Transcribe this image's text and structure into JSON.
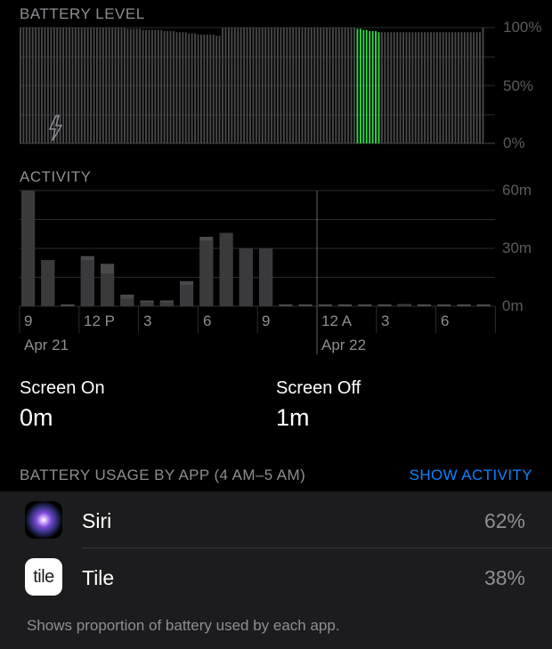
{
  "battery": {
    "label": "BATTERY LEVEL",
    "axis": [
      "100%",
      "50%",
      "0%"
    ],
    "charging_icon": "lightning-bolt-icon",
    "bar_color": "#48484a",
    "highlight_color": "#32d74b",
    "levels": [
      100,
      100,
      100,
      100,
      100,
      100,
      100,
      100,
      100,
      100,
      100,
      100,
      100,
      100,
      100,
      100,
      100,
      100,
      100,
      100,
      100,
      100,
      100,
      100,
      100,
      100,
      100,
      100,
      100,
      100,
      100,
      100,
      100,
      100,
      100,
      99,
      99,
      99,
      99,
      99,
      98,
      98,
      98,
      98,
      98,
      98,
      98,
      97,
      97,
      97,
      97,
      96,
      96,
      96,
      96,
      95,
      95,
      95,
      94,
      94,
      94,
      94,
      94,
      94,
      93,
      93,
      100,
      100,
      100,
      100,
      100,
      100,
      100,
      100,
      100,
      100,
      100,
      100,
      100,
      100,
      100,
      100,
      100,
      100,
      100,
      100,
      100,
      100,
      100,
      100,
      100,
      100,
      100,
      100,
      100,
      100,
      100,
      100,
      100,
      100,
      100,
      100,
      100,
      100,
      100,
      100,
      100,
      100,
      100,
      100,
      99,
      99,
      98,
      98,
      97,
      97,
      97,
      96,
      96,
      96,
      96,
      96,
      96,
      96,
      96,
      96,
      96,
      96,
      96,
      96,
      96,
      96,
      96,
      96,
      96,
      96,
      96,
      96,
      96,
      96,
      96,
      96,
      96,
      96,
      96,
      96,
      96,
      96,
      96,
      96,
      96,
      100
    ],
    "highlight_index_range": [
      110,
      118
    ]
  },
  "activity": {
    "label": "ACTIVITY",
    "axis": [
      "60m",
      "30m",
      "0m"
    ],
    "time_ticks": [
      "9",
      "12 P",
      "3",
      "6",
      "9",
      "12 A",
      "3",
      "6"
    ],
    "date_labels": [
      "Apr 21",
      "Apr 22"
    ],
    "bar_color": "#3a3a3c",
    "highlight_color": "#64d2ff",
    "screen_on_minutes": [
      60,
      24,
      0,
      24,
      17,
      4,
      2,
      2,
      11,
      34,
      38,
      30,
      30,
      0,
      0,
      0,
      0,
      0,
      0,
      1,
      0,
      0,
      0,
      0
    ],
    "screen_off_minutes": [
      0,
      0,
      1,
      2,
      5,
      2,
      1,
      1,
      2,
      2,
      0,
      0,
      0,
      1,
      1,
      1,
      1,
      1,
      1,
      0,
      1,
      1,
      1,
      1
    ],
    "highlight_hour_index": 19
  },
  "screen": {
    "on_label": "Screen On",
    "on_value": "0m",
    "off_label": "Screen Off",
    "off_value": "1m",
    "label_color": "#0a84ff"
  },
  "usage": {
    "header": "BATTERY USAGE BY APP (4 AM–5 AM)",
    "action": "SHOW ACTIVITY",
    "apps": [
      {
        "name": "Siri",
        "percent": "62%",
        "icon": "siri-icon"
      },
      {
        "name": "Tile",
        "percent": "38%",
        "icon": "tile-icon",
        "icon_text": "tile"
      }
    ]
  },
  "footer": {
    "text": "Shows proportion of battery used by each app."
  }
}
